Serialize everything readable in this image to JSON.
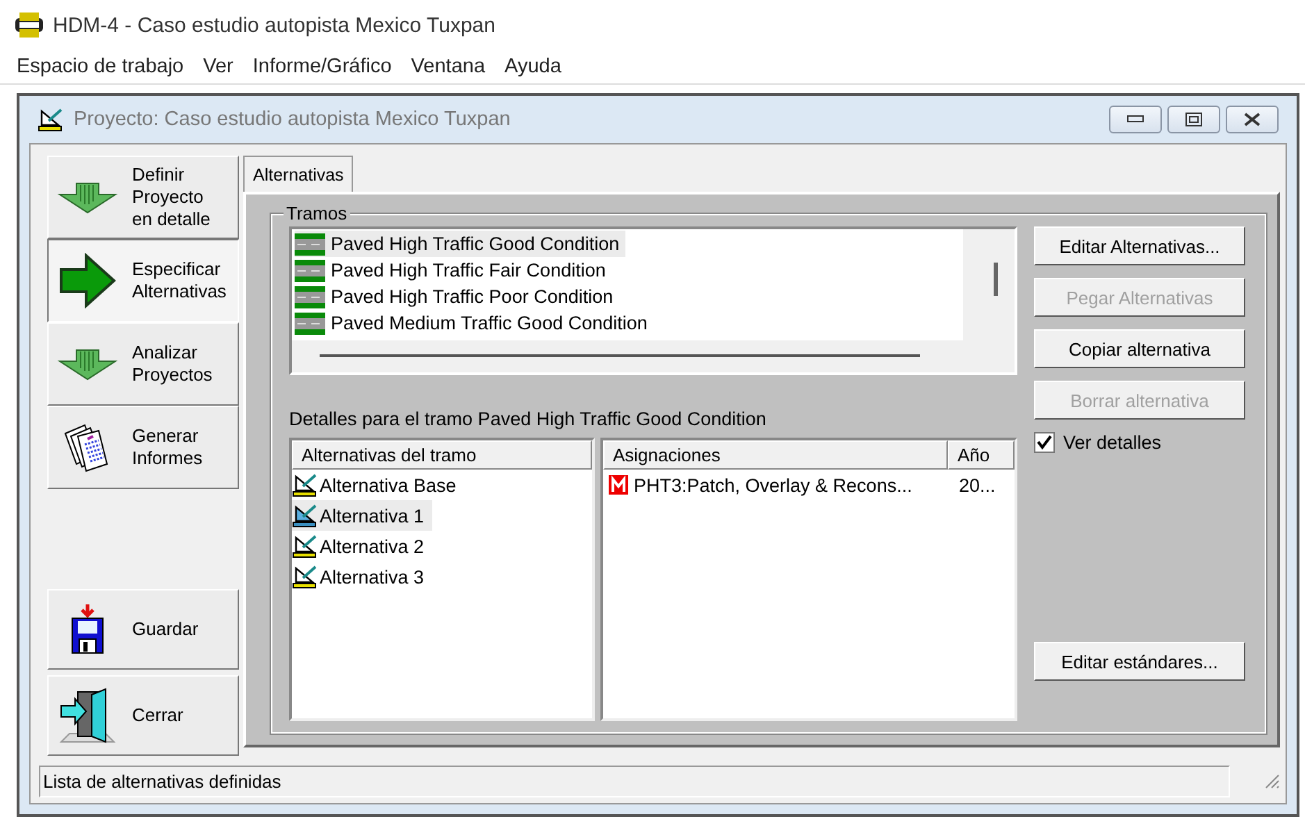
{
  "app": {
    "title": "HDM-4 - Caso estudio autopista Mexico Tuxpan"
  },
  "menu": [
    "Espacio de trabajo",
    "Ver",
    "Informe/Gráfico",
    "Ventana",
    "Ayuda"
  ],
  "window": {
    "title": "Proyecto: Caso estudio autopista Mexico Tuxpan"
  },
  "steps": [
    {
      "kind": "down",
      "label": "Definir\nProyecto\nen detalle",
      "selected": false
    },
    {
      "kind": "right",
      "label": "Especificar\nAlternativas",
      "selected": true
    },
    {
      "kind": "down",
      "label": "Analizar\nProyectos",
      "selected": false
    },
    {
      "kind": "report",
      "label": "Generar\nInformes",
      "selected": false
    }
  ],
  "actions": [
    {
      "kind": "save",
      "label": "Guardar"
    },
    {
      "kind": "close",
      "label": "Cerrar"
    }
  ],
  "tabs": [
    {
      "label": "Alternativas",
      "selected": true
    }
  ],
  "tramos": {
    "title": "Tramos",
    "items": [
      {
        "label": "Paved High Traffic Good Condition",
        "selected": true
      },
      {
        "label": "Paved High Traffic Fair Condition",
        "selected": false
      },
      {
        "label": "Paved High Traffic Poor Condition",
        "selected": false
      },
      {
        "label": "Paved Medium Traffic Good Condition",
        "selected": false
      }
    ]
  },
  "detail_label": "Detalles para el tramo Paved High Traffic Good Condition",
  "alternatives": {
    "columns": [
      "Alternativas del tramo"
    ],
    "items": [
      {
        "label": "Alternativa Base",
        "selected": false
      },
      {
        "label": "Alternativa 1",
        "selected": true
      },
      {
        "label": "Alternativa 2",
        "selected": false
      },
      {
        "label": "Alternativa 3",
        "selected": false
      }
    ]
  },
  "assignments": {
    "columns": [
      "Asignaciones",
      "Año"
    ],
    "rows": [
      {
        "cells": [
          "PHT3:Patch, Overlay & Recons...",
          "20..."
        ]
      }
    ]
  },
  "buttons": [
    {
      "label": "Editar Alternativas...",
      "disabled": false
    },
    {
      "label": "Pegar Alternativas",
      "disabled": true
    },
    {
      "label": "Copiar alternativa",
      "disabled": false
    },
    {
      "label": "Borrar alternativa",
      "disabled": true
    }
  ],
  "ver_detalles": {
    "label": "Ver detalles",
    "checked": true
  },
  "standards_button": {
    "label": "Editar estándares...",
    "disabled": false
  },
  "status_bar": "Lista de alternativas definidas"
}
